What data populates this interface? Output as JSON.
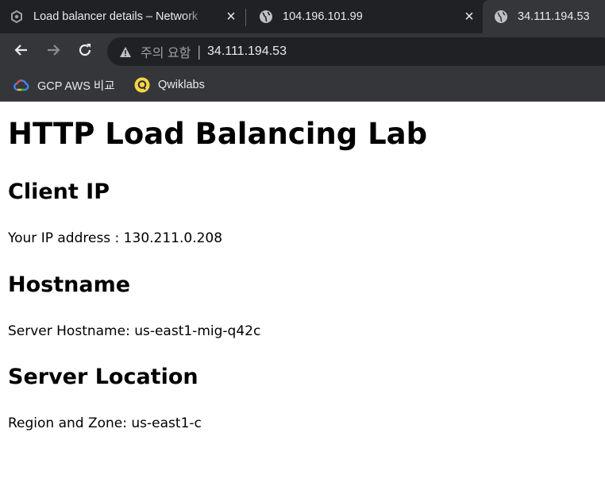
{
  "browser": {
    "tabs": [
      {
        "title": "Load balancer details – Network",
        "icon": "gcp-hexagon-icon",
        "active": false
      },
      {
        "title": "104.196.101.99",
        "icon": "globe-icon",
        "active": false
      },
      {
        "title": "34.111.194.53",
        "icon": "globe-icon",
        "active": true
      }
    ],
    "omnibox": {
      "security_label": "주의 요함",
      "separator": "|",
      "url": "34.111.194.53"
    },
    "bookmarks": [
      {
        "label": "GCP AWS 비교",
        "icon": "google-cloud-icon"
      },
      {
        "label": "Qwiklabs",
        "icon": "qwiklabs-icon"
      }
    ]
  },
  "page": {
    "title": "HTTP Load Balancing Lab",
    "sections": [
      {
        "heading": "Client IP",
        "text": "Your IP address : 130.211.0.208"
      },
      {
        "heading": "Hostname",
        "text": "Server Hostname: us-east1-mig-q42c"
      },
      {
        "heading": "Server Location",
        "text": "Region and Zone: us-east1-c"
      }
    ]
  },
  "colors": {
    "tabstrip_bg": "#202124",
    "toolbar_bg": "#35363a",
    "omnibox_bg": "#202124",
    "text_light": "#e8eaed",
    "text_muted": "#9aa0a6",
    "page_bg": "#ffffff"
  }
}
